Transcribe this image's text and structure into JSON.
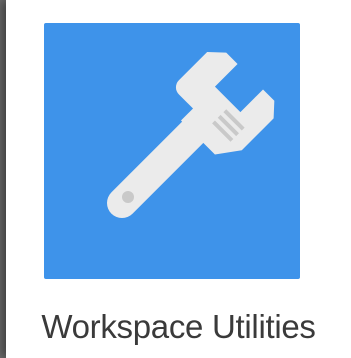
{
  "app": {
    "label": "Workspace Utilities",
    "icon": "wrench-icon",
    "tile_color": "#3e93ea",
    "glyph_color": "#ebebeb"
  }
}
